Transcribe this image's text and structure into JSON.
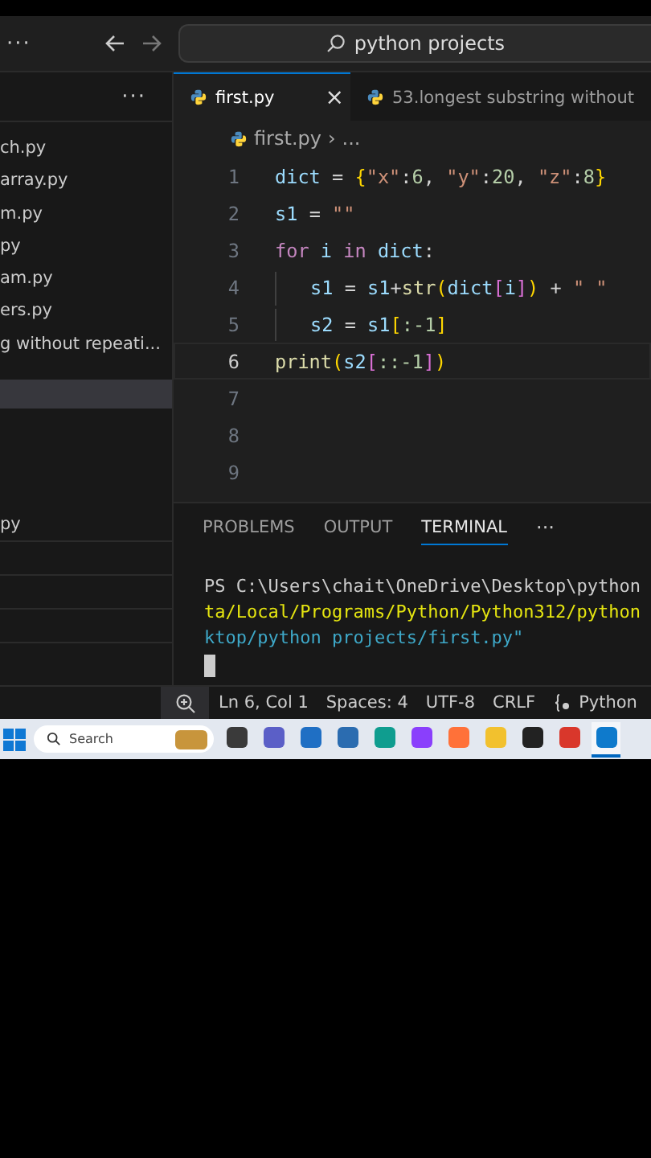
{
  "title_bar": {
    "menu": "···",
    "search": "python projects"
  },
  "sidebar": {
    "menu": "···",
    "items": [
      {
        "label": "ch.py",
        "selected": false
      },
      {
        "label": "array.py",
        "selected": false
      },
      {
        "label": "m.py",
        "selected": false
      },
      {
        "label": "py",
        "selected": false
      },
      {
        "label": "am.py",
        "selected": false
      },
      {
        "label": "ers.py",
        "selected": false
      },
      {
        "label": "g without repeati...",
        "selected": false
      }
    ],
    "lower_items": [
      {
        "label": "py",
        "selected": false
      }
    ]
  },
  "tabs": [
    {
      "label": "first.py",
      "selected": true,
      "close": "×"
    },
    {
      "label": "53.longest substring without",
      "selected": false
    }
  ],
  "breadcrumb": {
    "file": "first.py",
    "separator": "›",
    "rest": "..."
  },
  "code": {
    "lines": [
      {
        "number": "1",
        "indent": false,
        "current": false,
        "tokens": [
          {
            "text": "dict",
            "color": "#9cdcfe"
          },
          {
            "text": " = ",
            "color": "#d4d4d4"
          },
          {
            "text": "{",
            "color": "#ffd700"
          },
          {
            "text": "\"x\"",
            "color": "#ce9178"
          },
          {
            "text": ":",
            "color": "#d4d4d4"
          },
          {
            "text": "6",
            "color": "#b5cea8"
          },
          {
            "text": ", ",
            "color": "#d4d4d4"
          },
          {
            "text": "\"y\"",
            "color": "#ce9178"
          },
          {
            "text": ":",
            "color": "#d4d4d4"
          },
          {
            "text": "20",
            "color": "#b5cea8"
          },
          {
            "text": ", ",
            "color": "#d4d4d4"
          },
          {
            "text": "\"z\"",
            "color": "#ce9178"
          },
          {
            "text": ":",
            "color": "#d4d4d4"
          },
          {
            "text": "8",
            "color": "#b5cea8"
          },
          {
            "text": "}",
            "color": "#ffd700"
          }
        ]
      },
      {
        "number": "2",
        "indent": false,
        "current": false,
        "tokens": [
          {
            "text": "s1",
            "color": "#9cdcfe"
          },
          {
            "text": " = ",
            "color": "#d4d4d4"
          },
          {
            "text": "\"\"",
            "color": "#ce9178"
          }
        ]
      },
      {
        "number": "3",
        "indent": false,
        "current": false,
        "tokens": [
          {
            "text": "for ",
            "color": "#c586c0"
          },
          {
            "text": "i ",
            "color": "#9cdcfe"
          },
          {
            "text": "in ",
            "color": "#c586c0"
          },
          {
            "text": "dict",
            "color": "#9cdcfe"
          },
          {
            "text": ":",
            "color": "#d4d4d4"
          }
        ]
      },
      {
        "number": "4",
        "indent": true,
        "current": false,
        "tokens": [
          {
            "text": "s1",
            "color": "#9cdcfe"
          },
          {
            "text": " = ",
            "color": "#d4d4d4"
          },
          {
            "text": "s1",
            "color": "#9cdcfe"
          },
          {
            "text": "+",
            "color": "#d4d4d4"
          },
          {
            "text": "str",
            "color": "#dcdcaa"
          },
          {
            "text": "(",
            "color": "#ffd700"
          },
          {
            "text": "dict",
            "color": "#9cdcfe"
          },
          {
            "text": "[",
            "color": "#da70d6"
          },
          {
            "text": "i",
            "color": "#9cdcfe"
          },
          {
            "text": "]",
            "color": "#da70d6"
          },
          {
            "text": ")",
            "color": "#ffd700"
          },
          {
            "text": " + ",
            "color": "#d4d4d4"
          },
          {
            "text": "\" \"",
            "color": "#ce9178"
          }
        ]
      },
      {
        "number": "5",
        "indent": true,
        "current": false,
        "tokens": [
          {
            "text": "s2",
            "color": "#9cdcfe"
          },
          {
            "text": " = ",
            "color": "#d4d4d4"
          },
          {
            "text": "s1",
            "color": "#9cdcfe"
          },
          {
            "text": "[",
            "color": "#ffd700"
          },
          {
            "text": ":-1",
            "color": "#b5cea8"
          },
          {
            "text": "]",
            "color": "#ffd700"
          }
        ]
      },
      {
        "number": "6",
        "indent": false,
        "current": true,
        "tokens": [
          {
            "text": "print",
            "color": "#dcdcaa"
          },
          {
            "text": "(",
            "color": "#ffd700"
          },
          {
            "text": "s2",
            "color": "#9cdcfe"
          },
          {
            "text": "[",
            "color": "#da70d6"
          },
          {
            "text": "::-1",
            "color": "#b5cea8"
          },
          {
            "text": "]",
            "color": "#da70d6"
          },
          {
            "text": ")",
            "color": "#ffd700"
          }
        ]
      },
      {
        "number": "7",
        "indent": false,
        "current": false
      },
      {
        "number": "8",
        "indent": false,
        "current": false
      },
      {
        "number": "9",
        "indent": false,
        "current": false
      }
    ]
  },
  "panel_tabs": [
    {
      "label": "PROBLEMS",
      "selected": false
    },
    {
      "label": "OUTPUT",
      "selected": false
    },
    {
      "label": "TERMINAL",
      "selected": true
    }
  ],
  "panel_menu": "···",
  "terminal": {
    "lines": [
      {
        "text": "PS C:\\Users\\chait\\OneDrive\\Desktop\\python",
        "color": "#cccccc"
      },
      {
        "text": "ta/Local/Programs/Python/Python312/python",
        "color": "#e5e510"
      },
      {
        "text": "ktop/python projects/first.py\"",
        "color": "#3ea8c8"
      }
    ]
  },
  "status_bar": {
    "items": [
      "Ln 6, Col 1",
      "Spaces: 4",
      "UTF-8",
      "CRLF"
    ],
    "language": "Python"
  },
  "taskbar": {
    "search_placeholder": "Search",
    "apps": [
      {
        "color": "#3a3a3a",
        "selected": false
      },
      {
        "color": "#5b5fc7",
        "selected": false
      },
      {
        "color": "#1f6fc4",
        "selected": false
      },
      {
        "color": "#2b6cb0",
        "selected": false
      },
      {
        "color": "#0f9d8f",
        "selected": false
      },
      {
        "color": "#8a3ffc",
        "selected": false
      },
      {
        "color": "#ff7139",
        "selected": false
      },
      {
        "color": "#f2c12e",
        "selected": false
      },
      {
        "color": "#222222",
        "selected": false
      },
      {
        "color": "#d9372b",
        "selected": false
      },
      {
        "color": "#0e7acc",
        "selected": true
      }
    ]
  }
}
